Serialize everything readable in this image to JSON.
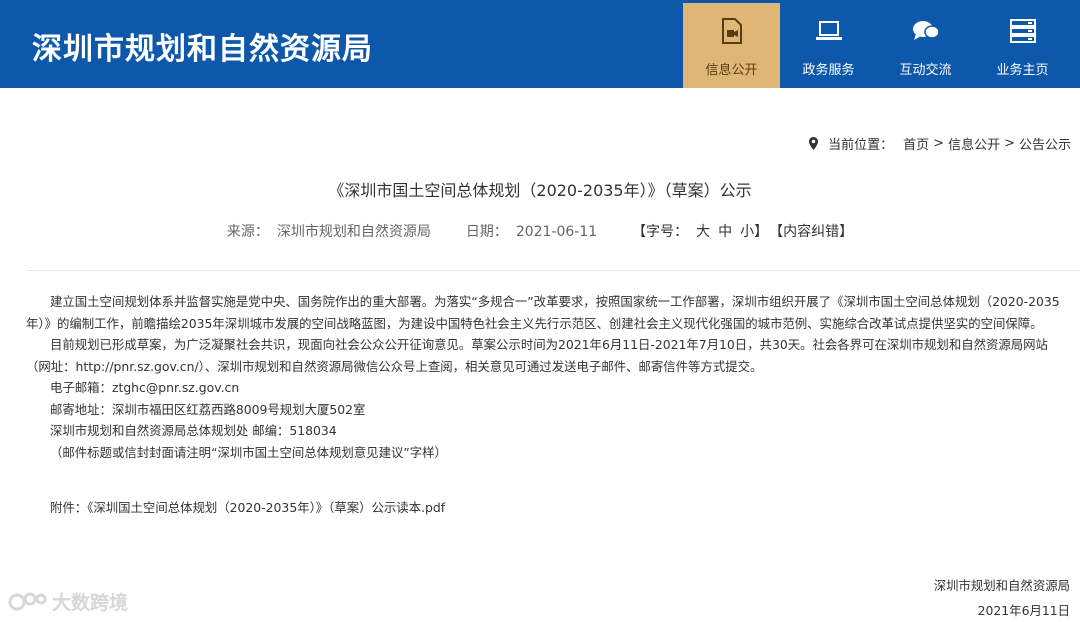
{
  "header": {
    "site_title": "深圳市规划和自然资源局",
    "brand_color": "#0d58ab",
    "active_color": "#dfb675",
    "nav": [
      {
        "label": "信息公开",
        "icon": "document-video-icon",
        "active": true
      },
      {
        "label": "政务服务",
        "icon": "laptop-icon",
        "active": false
      },
      {
        "label": "互动交流",
        "icon": "chat-bubbles-icon",
        "active": false
      },
      {
        "label": "业务主页",
        "icon": "server-icon",
        "active": false
      }
    ]
  },
  "breadcrumb": {
    "prefix": "当前位置：",
    "items": [
      "首页",
      "信息公开",
      "公告公示"
    ],
    "separator": ">"
  },
  "article": {
    "title": "《深圳市国土空间总体规划（2020-2035年）》（草案）公示",
    "source_label": "来源：",
    "source": "深圳市规划和自然资源局",
    "date_label": "日期：",
    "date": "2021-06-11",
    "font_label": "【字号：",
    "font_large": "大",
    "font_medium": "中",
    "font_small": "小】",
    "correction": "【内容纠错】",
    "paragraph1": "建立国土空间规划体系并监督实施是党中央、国务院作出的重大部署。为落实“多规合一”改革要求，按照国家统一工作部署，深圳市组织开展了《深圳市国土空间总体规划（2020-2035年）》的编制工作，前瞻描绘2035年深圳城市发展的空间战略蓝图，为建设中国特色社会主义先行示范区、创建社会主义现代化强国的城市范例、实施综合改革试点提供坚实的空间保障。",
    "paragraph2": "目前规划已形成草案，为广泛凝聚社会共识，现面向社会公众公开征询意见。草案公示时间为2021年6月11日-2021年7月10日，共30天。社会各界可在深圳市规划和自然资源局网站（网址：http://pnr.sz.gov.cn/）、深圳市规划和自然资源局微信公众号上查阅，相关意见可通过发送电子邮件、邮寄信件等方式提交。",
    "email": "电子邮箱：ztghc@pnr.sz.gov.cn",
    "address": "邮寄地址：深圳市福田区红荔西路8009号规划大厦502室",
    "postcode": "深圳市规划和自然资源局总体规划处 邮编：518034",
    "note": "（邮件标题或信封封面请注明“深圳市国土空间总体规划意见建议”字样）",
    "attachment_label": "附件：",
    "attachment": "《深圳国土空间总体规划（2020-2035年）》（草案）公示读本.pdf",
    "sign_org": "深圳市规划和自然资源局",
    "sign_date": "2021年6月11日"
  },
  "watermark": {
    "text": "大数跨境"
  }
}
